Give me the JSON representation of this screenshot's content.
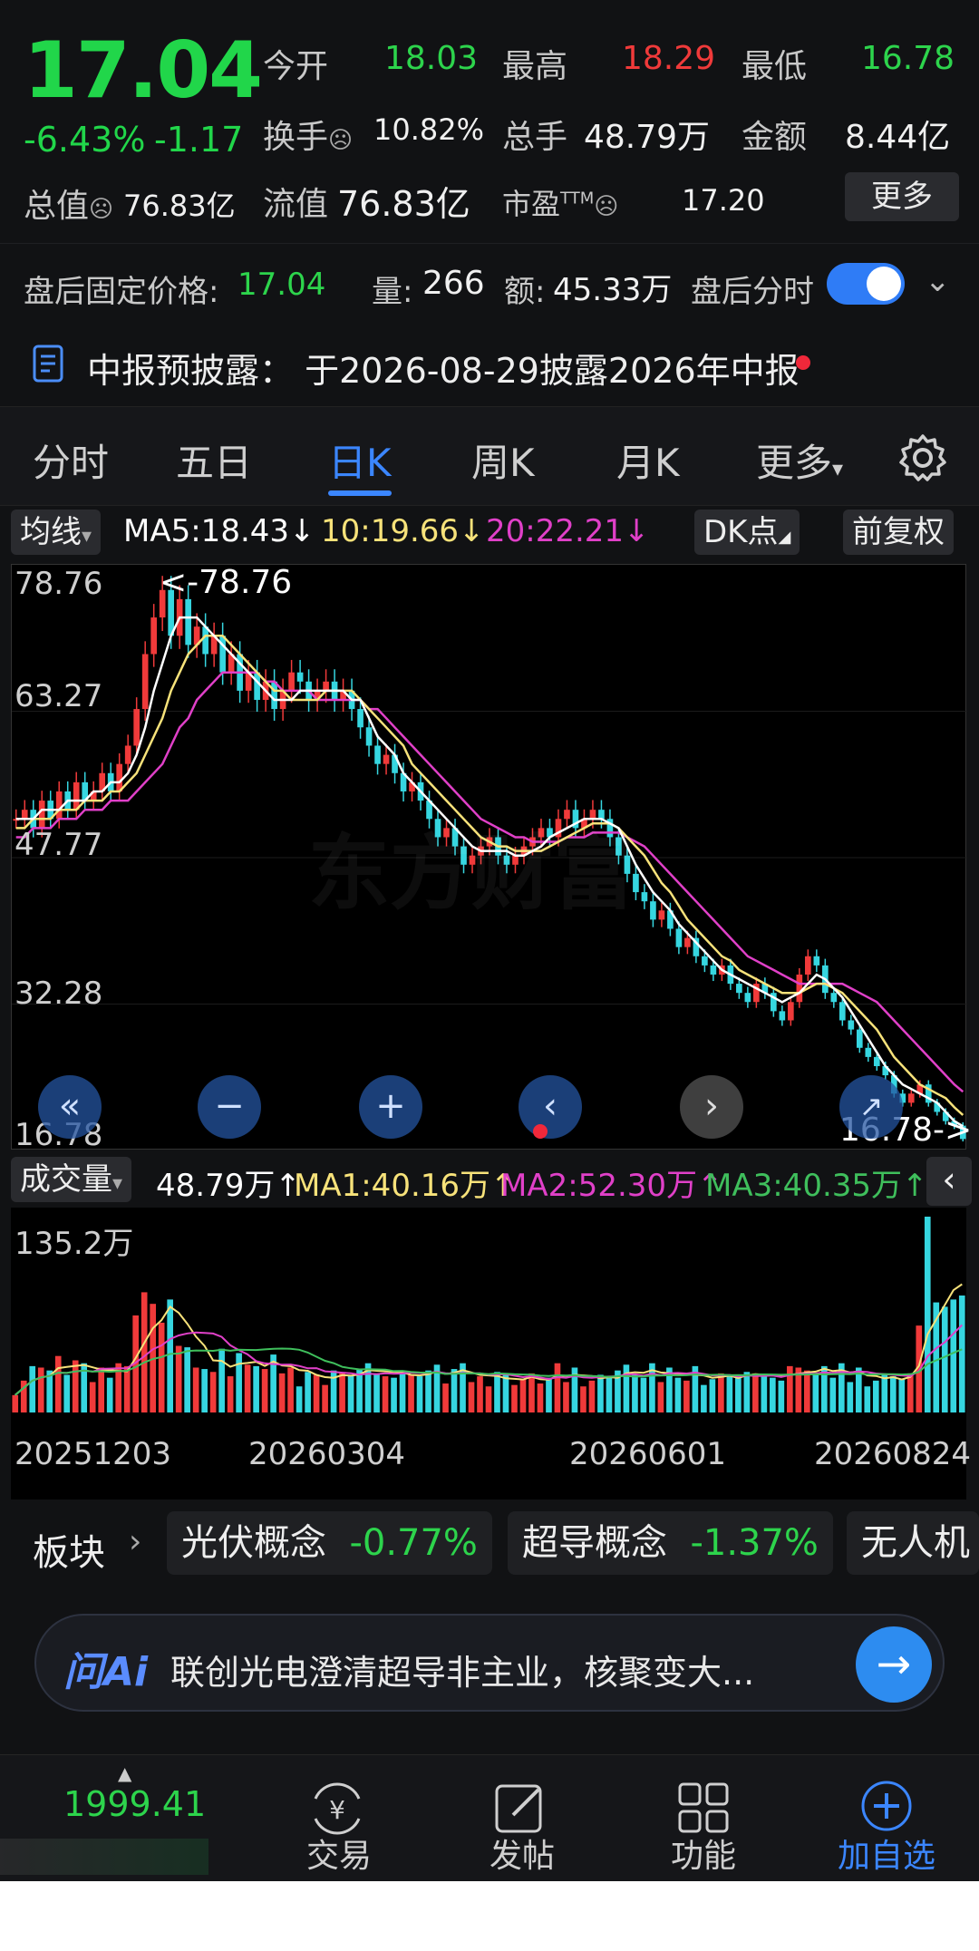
{
  "quote": {
    "price": "17.04",
    "change_pct": "-6.43%",
    "change_abs": "-1.17",
    "open_label": "今开",
    "open": "18.03",
    "high_label": "最高",
    "high": "18.29",
    "low_label": "最低",
    "low": "16.78",
    "turnover_label": "换手",
    "turnover": "10.82%",
    "volume_label": "总手",
    "volume": "48.79万",
    "amount_label": "金额",
    "amount": "8.44亿",
    "mktcap_label": "总值",
    "mktcap": "76.83亿",
    "float_label": "流值",
    "float_cap": "76.83亿",
    "pe_label": "市盈",
    "pe_sup": "TTM",
    "pe": "17.20",
    "more_label": "更多"
  },
  "after_hours": {
    "price_label": "盘后固定价格:",
    "price": "17.04",
    "vol_label": "量:",
    "vol": "266",
    "amt_label": "额:",
    "amt": "45.33万",
    "toggle_label": "盘后分时"
  },
  "notice": {
    "text": "中报预披露：  于2026-08-29披露2026年中报"
  },
  "tabs": [
    {
      "label": "分时"
    },
    {
      "label": "五日"
    },
    {
      "label": "日K"
    },
    {
      "label": "周K"
    },
    {
      "label": "月K"
    },
    {
      "label": "更多"
    }
  ],
  "ma_bar": {
    "selector": "均线",
    "ma5": "MA5:18.43↓",
    "ma10": "10:19.66↓",
    "ma20": "20:22.21↓",
    "dk": "DK点",
    "adjust": "前复权"
  },
  "price_axis": [
    "78.76",
    "63.27",
    "47.77",
    "32.28",
    "16.78"
  ],
  "annotations": {
    "high": "<-78.76",
    "low": "16.78->"
  },
  "vol_bar": {
    "selector": "成交量",
    "vol": "48.79万↑",
    "ma1": "MA1:40.16万↑",
    "ma2": "MA2:52.30万↑",
    "ma3": "MA3:40.35万↑",
    "max_label": "135.2万"
  },
  "dates": [
    "20251203",
    "20260304",
    "20260601",
    "20260824"
  ],
  "sectors": {
    "label": "板块",
    "items": [
      {
        "name": "光伏概念",
        "chg": "-0.77%"
      },
      {
        "name": "超导概念",
        "chg": "-1.37%"
      },
      {
        "name": "无人机",
        "chg": ""
      }
    ]
  },
  "ai": {
    "logo": "问Ai",
    "text": "联创光电澄清超导非主业，核聚变大..."
  },
  "bottom_nav": {
    "index_value": "1999.41",
    "items": [
      {
        "label": "交易"
      },
      {
        "label": "发帖"
      },
      {
        "label": "功能"
      },
      {
        "label": "加自选"
      }
    ]
  },
  "colors": {
    "up": "#f03a3a",
    "down": "#2dd44c",
    "accent": "#3b86ff",
    "ma5": "#ffffff",
    "ma10": "#f7e27a",
    "ma20": "#e040c8",
    "ma3": "#3fbf5c",
    "down_candle": "#36d6e0"
  },
  "chart_data": {
    "type": "candlestick",
    "ylim": [
      16.78,
      78.76
    ],
    "close": [
      52,
      53,
      51,
      54,
      52,
      55,
      53,
      56,
      54,
      55,
      57,
      55,
      58,
      60,
      64,
      70,
      74,
      77,
      72,
      76,
      71,
      73,
      70,
      72,
      68,
      70,
      66,
      68,
      65,
      67,
      64,
      66,
      68,
      67,
      65,
      66,
      67,
      65,
      66,
      64,
      62,
      60,
      58,
      59,
      57,
      55,
      56,
      54,
      52,
      50,
      51,
      49,
      47,
      48,
      49,
      50,
      48,
      47,
      48,
      49,
      50,
      51,
      50,
      52,
      53,
      51,
      52,
      53,
      52,
      50,
      48,
      46,
      44,
      43,
      41,
      42,
      40,
      38,
      39,
      37,
      36,
      35,
      36,
      34,
      33,
      32,
      34,
      33,
      31,
      30,
      32,
      35,
      37,
      36,
      33,
      32,
      30,
      29,
      27,
      26,
      25,
      24,
      22,
      21,
      22,
      23,
      21,
      20,
      19,
      18.5,
      17.04
    ],
    "ma5": [
      52,
      52,
      52,
      53,
      53,
      53,
      54,
      54,
      54,
      55,
      55,
      56,
      56,
      57,
      59,
      62,
      66,
      69,
      72,
      74,
      74,
      74,
      73,
      72,
      71,
      70,
      69,
      68,
      67,
      66,
      65,
      65,
      65,
      66,
      66,
      66,
      66,
      66,
      66,
      65,
      65,
      63,
      61,
      60,
      59,
      57,
      56,
      55,
      54,
      53,
      52,
      51,
      50,
      49,
      48.5,
      48.5,
      48.5,
      48.5,
      48,
      48,
      48.5,
      49,
      50,
      50.5,
      51,
      51.5,
      52,
      52,
      52,
      51.5,
      51,
      49,
      47,
      45.5,
      44,
      43,
      42,
      40.5,
      39.5,
      38.5,
      37.5,
      36.5,
      35.5,
      35,
      34.5,
      34,
      33.5,
      33,
      32.5,
      32,
      32.5,
      33,
      34,
      35,
      34.5,
      33.5,
      32.5,
      31,
      29.5,
      28,
      26.5,
      25,
      24,
      23,
      22.5,
      22,
      21.5,
      21,
      20,
      19,
      18.43
    ],
    "ma10": [
      51,
      51,
      52,
      52,
      52,
      53,
      53,
      53,
      54,
      54,
      54,
      55,
      55,
      56,
      57,
      59,
      61,
      63,
      66,
      68,
      70,
      71,
      72,
      72,
      72,
      71,
      70,
      69,
      68,
      67,
      66,
      66,
      65,
      65,
      65,
      65,
      66,
      66,
      66,
      66,
      65,
      64,
      63,
      62,
      61,
      60,
      58,
      57,
      56,
      55,
      54,
      53,
      52,
      51,
      50,
      49.5,
      49,
      49,
      48.5,
      48.5,
      48.5,
      48.5,
      49,
      49.5,
      50,
      50.5,
      51,
      51.5,
      51.5,
      51.5,
      51,
      50,
      49,
      48,
      46.5,
      45,
      44,
      42.5,
      41,
      40,
      39,
      38,
      37,
      36.5,
      35.5,
      35,
      34.5,
      34,
      33.5,
      33,
      33,
      33,
      33.5,
      34,
      34,
      33.5,
      33,
      32,
      31,
      30,
      29,
      27.5,
      26,
      25,
      24,
      23,
      22.5,
      22,
      21.5,
      20.5,
      19.66
    ],
    "ma20": [
      50,
      50,
      51,
      51,
      51,
      52,
      52,
      52,
      53,
      53,
      53,
      54,
      54,
      54,
      55,
      56,
      57,
      58,
      60,
      62,
      63,
      65,
      66,
      67,
      68,
      68,
      68,
      68,
      68,
      67,
      67,
      66,
      66,
      66,
      66,
      65,
      65,
      65,
      65,
      65,
      65,
      64,
      64,
      63,
      62,
      61,
      60,
      59,
      58,
      57,
      56,
      55,
      54,
      53,
      52,
      51.5,
      51,
      50.5,
      50,
      50,
      49.5,
      49.5,
      49.5,
      49.5,
      50,
      50,
      50,
      50.5,
      50.5,
      50.5,
      50.5,
      50,
      49.5,
      49,
      48,
      47,
      46,
      45,
      44,
      43,
      42,
      41,
      40,
      39,
      38,
      37,
      36.5,
      36,
      35.5,
      35,
      34.5,
      34,
      34,
      34,
      34,
      34,
      34,
      33.5,
      33,
      32.5,
      32,
      31,
      30,
      29,
      28,
      27,
      26,
      25,
      24,
      23,
      22.21
    ],
    "volume_max": 135.2
  }
}
